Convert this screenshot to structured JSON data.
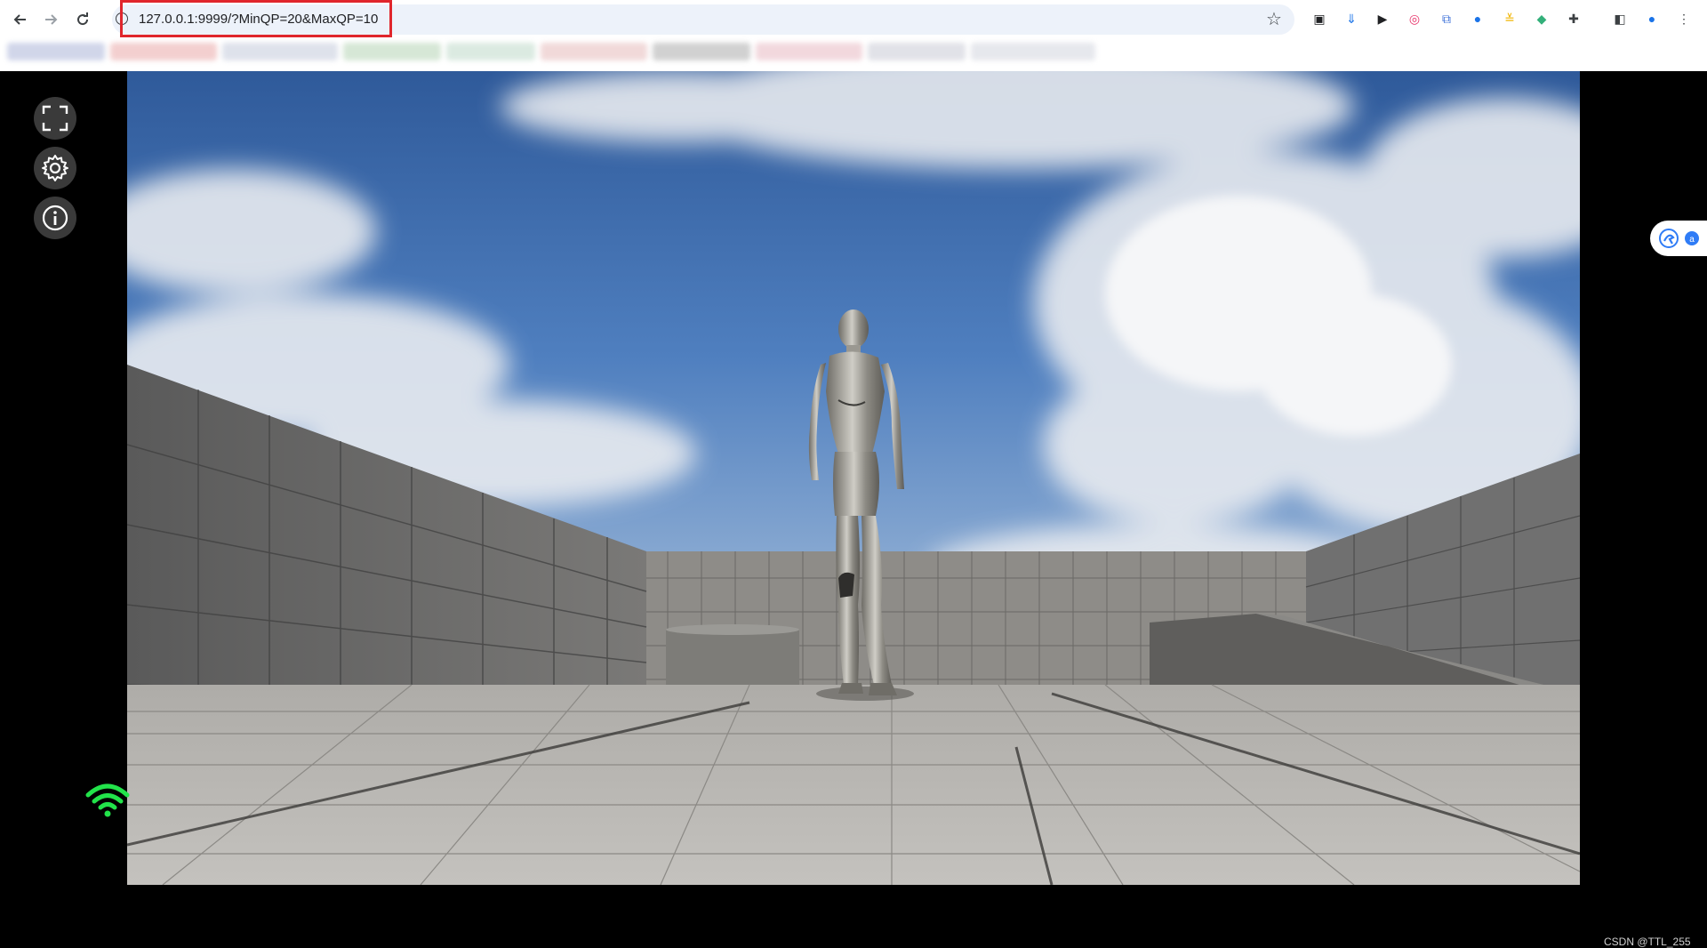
{
  "browser": {
    "url": "127.0.0.1:9999/?MinQP=20&MaxQP=10",
    "nav": {
      "back_icon": "arrow-left",
      "forward_icon": "arrow-right",
      "reload_icon": "reload"
    },
    "extensions": [
      {
        "name": "ext-1-icon",
        "glyph": "▣",
        "color": "#202124"
      },
      {
        "name": "ext-2-icon",
        "glyph": "⇓",
        "color": "#1a73e8"
      },
      {
        "name": "ext-3-icon",
        "glyph": "▶",
        "color": "#202124"
      },
      {
        "name": "ext-4-icon",
        "glyph": "◎",
        "color": "#e8336a"
      },
      {
        "name": "ext-5-icon",
        "glyph": "⧉",
        "color": "#3b6fd8"
      },
      {
        "name": "ext-6-icon",
        "glyph": "●",
        "color": "#1a73e8"
      },
      {
        "name": "ext-7-icon",
        "glyph": "≚",
        "color": "#f0b400"
      },
      {
        "name": "ext-8-icon",
        "glyph": "◆",
        "color": "#33b07a"
      },
      {
        "name": "extensions-puzzle-icon",
        "glyph": "✚",
        "color": "#3c4043"
      },
      {
        "name": "side-panel-icon",
        "glyph": "◧",
        "color": "#3c4043"
      },
      {
        "name": "profile-avatar-icon",
        "glyph": "●",
        "color": "#1a73e8"
      },
      {
        "name": "browser-menu-icon",
        "glyph": "⋮",
        "color": "#3c4043"
      }
    ]
  },
  "controls": {
    "fullscreen_icon": "fullscreen-icon",
    "settings_icon": "gear-icon",
    "info_icon": "info-icon"
  },
  "status": {
    "connection_color": "#22e34a"
  },
  "watermark": "CSDN @TTL_255"
}
